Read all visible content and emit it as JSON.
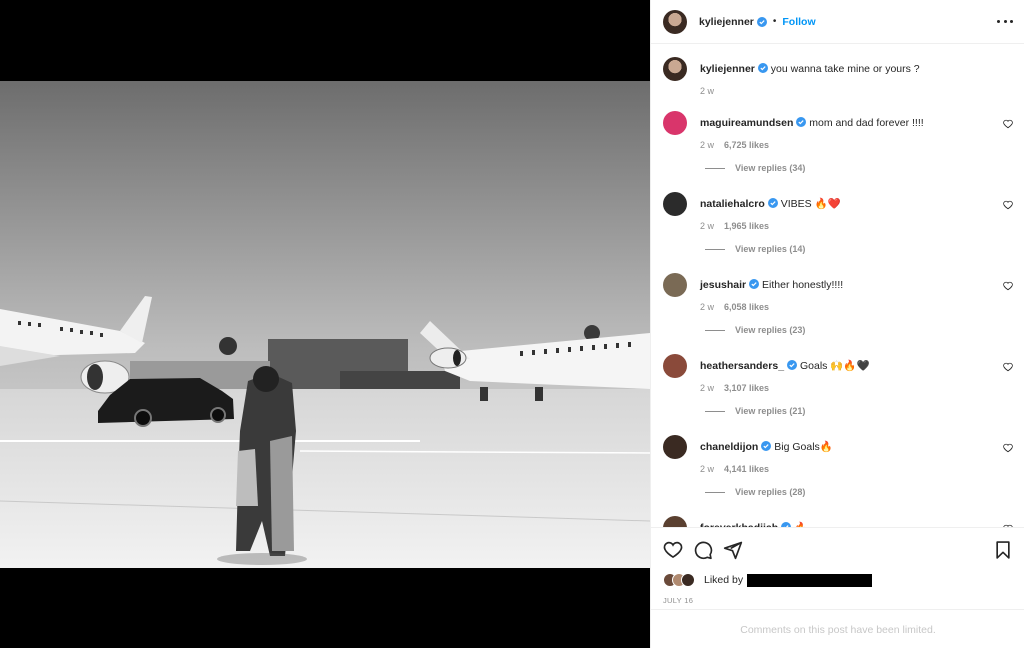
{
  "post": {
    "author": "kyliejenner",
    "follow_label": "Follow",
    "separator": "•",
    "caption": "you wanna take mine or yours ?",
    "caption_time": "2 w"
  },
  "comments": [
    {
      "user": "maguireamundsen",
      "text": "mom and dad forever !!!!",
      "time": "2 w",
      "likes": "6,725 likes",
      "replies": "View replies (34)",
      "avatar_color": "#d9356b"
    },
    {
      "user": "nataliehalcro",
      "text": "VIBES 🔥❤️",
      "time": "2 w",
      "likes": "1,965 likes",
      "replies": "View replies (14)",
      "avatar_color": "#2b2b2b"
    },
    {
      "user": "jesushair",
      "text": "Either honestly!!!!",
      "time": "2 w",
      "likes": "6,058 likes",
      "replies": "View replies (23)",
      "avatar_color": "#7a6a55"
    },
    {
      "user": "heathersanders_",
      "text": "Goals 🙌🔥🖤",
      "time": "2 w",
      "likes": "3,107 likes",
      "replies": "View replies (21)",
      "avatar_color": "#8a4a3a"
    },
    {
      "user": "chaneldijon",
      "text": "Big Goals🔥",
      "time": "2 w",
      "likes": "4,141 likes",
      "replies": "View replies (28)",
      "avatar_color": "#3a2a22"
    },
    {
      "user": "foreverkhadijah",
      "text": "🔥",
      "time": "",
      "likes": "",
      "replies": "",
      "avatar_color": "#5a4030"
    }
  ],
  "footer": {
    "liked_by_label": "Liked by",
    "date": "JULY 16",
    "comments_limited": "Comments on this post have been limited."
  },
  "colors": {
    "accent": "#0095f6",
    "verified": "#3897f0",
    "muted": "#8e8e8e"
  }
}
